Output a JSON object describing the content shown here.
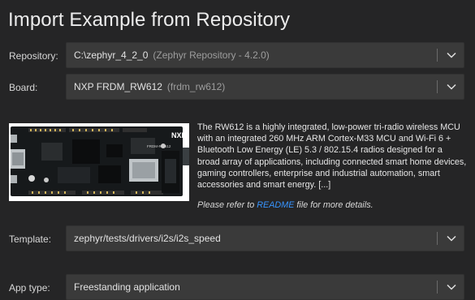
{
  "dialog": {
    "title": "Import Example from Repository"
  },
  "repository": {
    "label": "Repository:",
    "value": "C:\\zephyr_4_2_0",
    "hint": "(Zephyr Repository - 4.2.0)"
  },
  "board": {
    "label": "Board:",
    "value": "NXP FRDM_RW612",
    "hint": "(frdm_rw612)"
  },
  "board_info": {
    "description": "The RW612 is a highly integrated, low-power tri-radio wireless MCU with an integrated 260 MHz ARM Cortex-M33 MCU and Wi-Fi 6 + Bluetooth Low Energy (LE) 5.3 / 802.15.4 radios designed for a broad array of applications, including connected smart home devices, gaming controllers, enterprise and industrial automation, smart accessories and smart energy. [...]",
    "note_prefix": "Please refer to ",
    "note_link": "README",
    "note_suffix": " file for more details.",
    "image_text": "NXP",
    "image_board_text": "FRDM-RW612"
  },
  "template": {
    "label": "Template:",
    "value": "zephyr/tests/drivers/i2s/i2s_speed"
  },
  "app_type": {
    "label": "App type:",
    "value": "Freestanding application"
  },
  "colors": {
    "background": "#252526",
    "field": "#3a3a3a",
    "link": "#3794ff",
    "board_pcb": "#16191b"
  },
  "icons": {
    "dropdown": "chevron-down-icon"
  }
}
